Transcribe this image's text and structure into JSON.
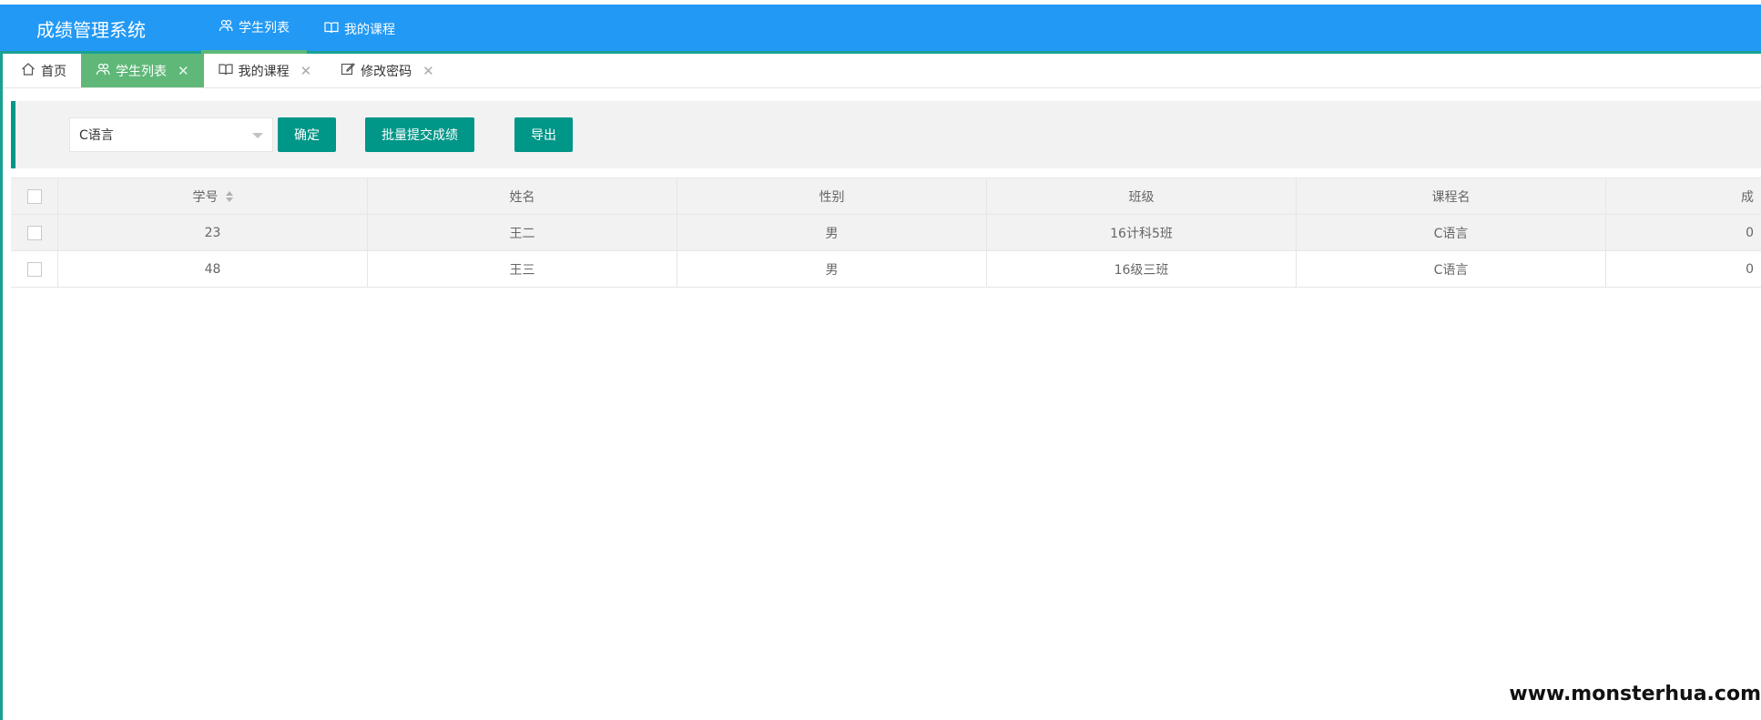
{
  "app": {
    "title": "成绩管理系统"
  },
  "topnav": [
    {
      "label": "学生列表",
      "icon": "users-icon",
      "active": true
    },
    {
      "label": "我的课程",
      "icon": "book-icon",
      "active": false
    }
  ],
  "tabs": [
    {
      "label": "首页",
      "icon": "home-icon",
      "closable": false,
      "active": false
    },
    {
      "label": "学生列表",
      "icon": "users-icon",
      "closable": true,
      "active": true
    },
    {
      "label": "我的课程",
      "icon": "book-icon",
      "closable": true,
      "active": false
    },
    {
      "label": "修改密码",
      "icon": "edit-icon",
      "closable": true,
      "active": false
    }
  ],
  "toolbar": {
    "course_select_value": "C语言",
    "confirm_label": "确定",
    "batch_submit_label": "批量提交成绩",
    "export_label": "导出"
  },
  "table": {
    "columns": [
      "学号",
      "姓名",
      "性别",
      "班级",
      "课程名",
      "成"
    ],
    "rows": [
      [
        "23",
        "王二",
        "男",
        "16计科5班",
        "C语言",
        "0"
      ],
      [
        "48",
        "王三",
        "男",
        "16级三班",
        "C语言",
        "0"
      ]
    ]
  },
  "watermark": "www.monsterhua.com",
  "colors": {
    "header_bg": "#2299f5",
    "accent": "#009688",
    "active_tab": "#5fb878"
  }
}
